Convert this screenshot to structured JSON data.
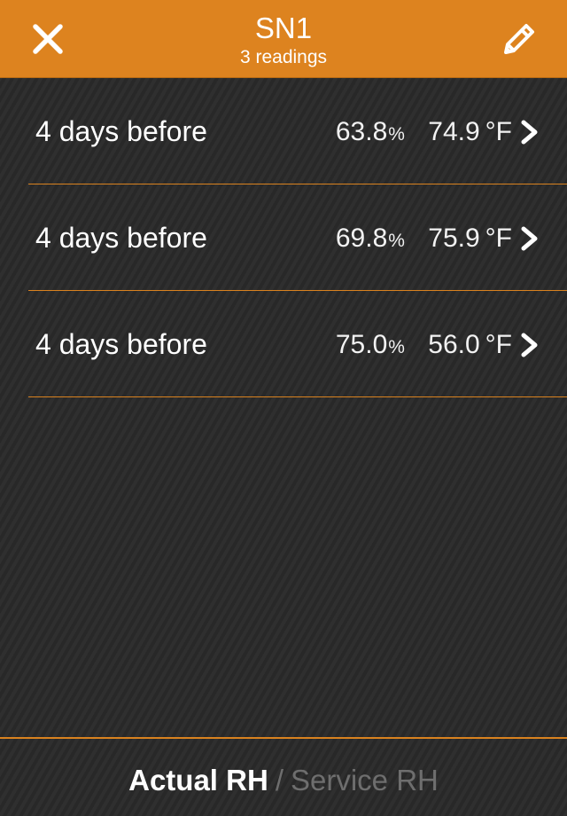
{
  "header": {
    "title": "SN1",
    "subtitle": "3 readings",
    "close_icon": "close-icon",
    "edit_icon": "pencil-icon",
    "color": "#dd831f"
  },
  "readings": [
    {
      "label": "4 days before",
      "rh": "63.8",
      "rh_unit": "%",
      "temp": "74.9",
      "temp_unit": "°F"
    },
    {
      "label": "4 days before",
      "rh": "69.8",
      "rh_unit": "%",
      "temp": "75.9",
      "temp_unit": "°F"
    },
    {
      "label": "4 days before",
      "rh": "75.0",
      "rh_unit": "%",
      "temp": "56.0",
      "temp_unit": "°F"
    }
  ],
  "footer": {
    "tab_actual": "Actual RH",
    "separator": "/",
    "tab_service": "Service RH",
    "active_tab": "Actual RH"
  }
}
